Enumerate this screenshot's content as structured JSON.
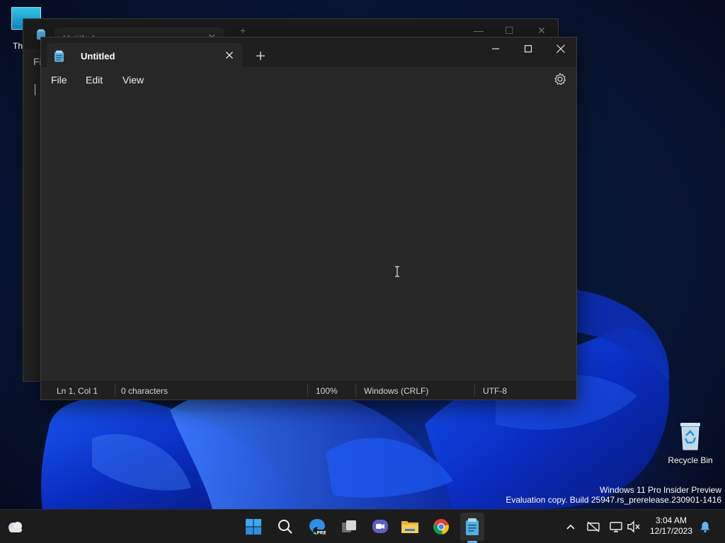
{
  "desktop": {
    "icons": [
      {
        "label": "Recycle Bin"
      },
      {
        "label": "Th"
      }
    ],
    "watermark": {
      "line1": "Windows 11 Pro Insider Preview",
      "line2": "Evaluation copy. Build 25947.rs_prerelease.230901-1416"
    }
  },
  "background_window": {
    "tab_title": "Untitled",
    "menu_first": "Fi"
  },
  "notepad": {
    "tab_title": "Untitled",
    "menu": [
      "File",
      "Edit",
      "View"
    ],
    "content": "",
    "status": {
      "position": "Ln 1, Col 1",
      "characters": "0 characters",
      "zoom": "100%",
      "line_endings": "Windows (CRLF)",
      "encoding": "UTF-8"
    },
    "icons": {
      "app": "notepad-icon",
      "close_tab": "close-icon",
      "new_tab": "plus-icon",
      "minimize": "minimize-icon",
      "maximize": "maximize-icon",
      "close": "close-icon",
      "settings": "gear-icon"
    }
  },
  "taskbar": {
    "apps": [
      "start",
      "search",
      "edge-pre",
      "task-view",
      "meet",
      "file-explorer",
      "chrome",
      "notepad"
    ],
    "active_app": "notepad",
    "tray": [
      "chevron-up-icon",
      "network-off-icon",
      "display-icon",
      "volume-muted-icon",
      "notification-bell-icon"
    ],
    "clock": {
      "time": "3:04 AM",
      "date": "12/17/2023"
    }
  },
  "colors": {
    "accent": "#5fb3f7",
    "window_bg": "#272727",
    "titlebar_bg": "#1f1f1f",
    "taskbar_bg": "#1c1c1c"
  }
}
